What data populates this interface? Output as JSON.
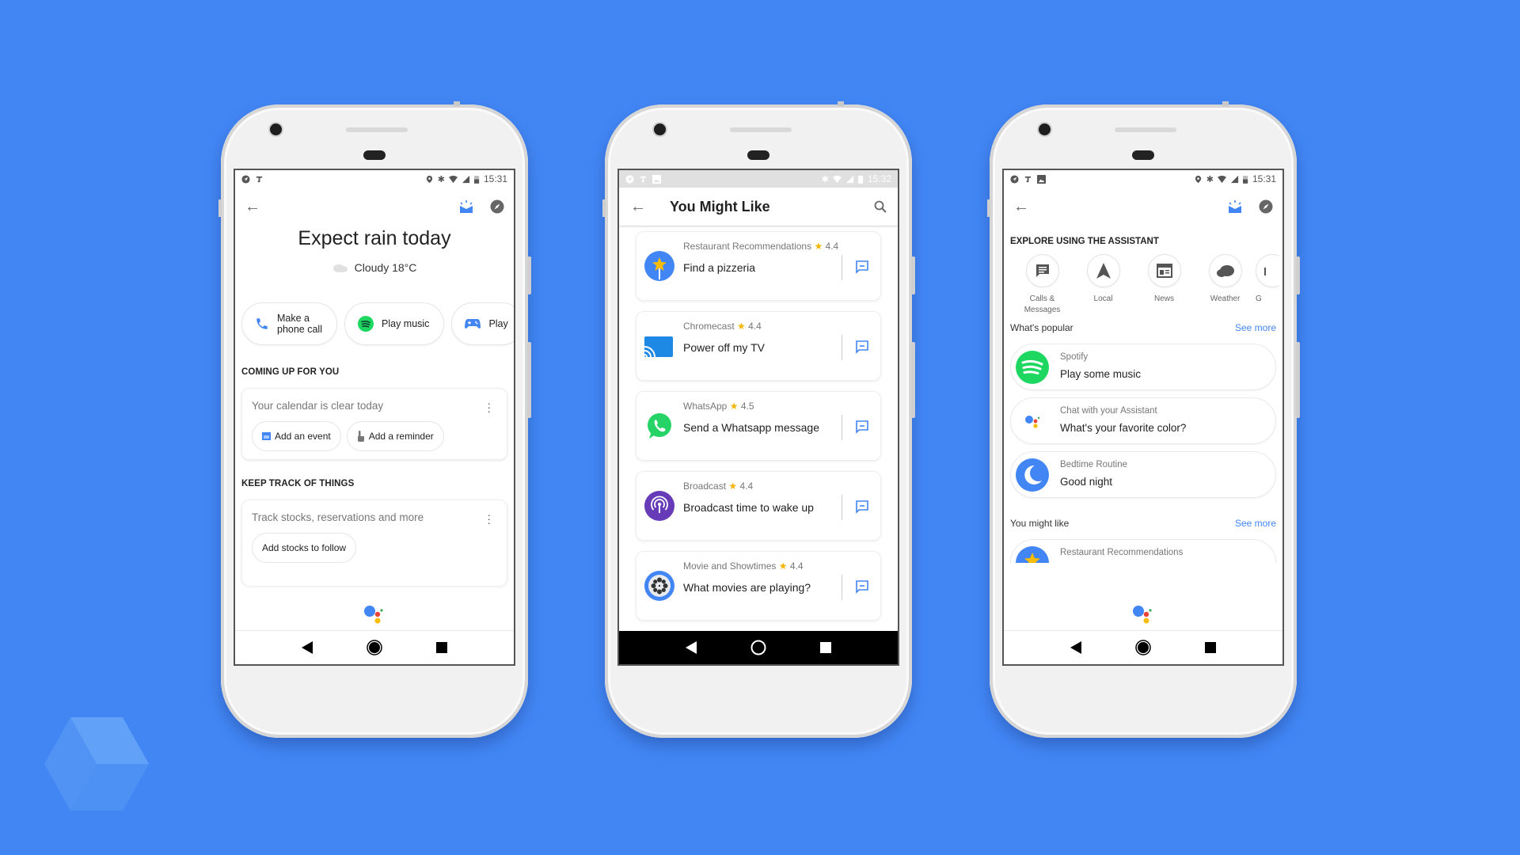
{
  "colors": {
    "background": "#4286f4",
    "accent_blue": "#4285f4",
    "spotify_green": "#1ed760",
    "whatsapp_green": "#25d366",
    "broadcast_purple": "#673ab7",
    "star_yellow": "#f5b400"
  },
  "phones": [
    {
      "status": {
        "left_icons": [
          "navigation-icon",
          "t-icon"
        ],
        "right_icons": [
          "location-icon",
          "bluetooth-icon",
          "wifi-icon",
          "signal-icon",
          "battery-icon"
        ],
        "time": "15:31"
      },
      "topbar": {
        "back": "back-arrow-icon",
        "icons": [
          "inbox-updates-icon",
          "explore-compass-icon"
        ]
      },
      "hero": {
        "title": "Expect rain today",
        "weather": "Cloudy 18°C"
      },
      "chips": [
        {
          "icon": "phone-icon",
          "label_line1": "Make a",
          "label_line2": "phone call"
        },
        {
          "icon": "spotify-icon",
          "label": "Play music"
        },
        {
          "icon": "gamepad-icon",
          "label": "Play"
        }
      ],
      "coming_up": {
        "heading": "COMING UP FOR YOU",
        "message": "Your calendar is clear today",
        "actions": [
          {
            "icon": "calendar-icon",
            "label": "Add an event"
          },
          {
            "icon": "reminder-hand-icon",
            "label": "Add a reminder"
          }
        ]
      },
      "keep_track": {
        "heading": "KEEP TRACK OF THINGS",
        "message": "Track stocks, reservations and more",
        "actions": [
          {
            "label": "Add stocks to follow"
          }
        ]
      }
    },
    {
      "status": {
        "left_icons": [
          "navigation-icon",
          "t-icon",
          "image-icon"
        ],
        "right_icons": [
          "bluetooth-icon",
          "wifi-icon",
          "signal-icon",
          "battery-icon"
        ],
        "time": "15:32"
      },
      "title": "You Might Like",
      "items": [
        {
          "category": "Restaurant Recommendations",
          "rating": "4.4",
          "query": "Find a pizzeria",
          "icon": "restaurant-icon"
        },
        {
          "category": "Chromecast",
          "rating": "4.4",
          "query": "Power off my TV",
          "icon": "chromecast-icon"
        },
        {
          "category": "WhatsApp",
          "rating": "4.5",
          "query": "Send a Whatsapp message",
          "icon": "whatsapp-icon"
        },
        {
          "category": "Broadcast",
          "rating": "4.4",
          "query": "Broadcast time to wake up",
          "icon": "broadcast-icon"
        },
        {
          "category": "Movie and Showtimes",
          "rating": "4.4",
          "query": "What movies are playing?",
          "icon": "movie-reel-icon"
        }
      ]
    },
    {
      "status": {
        "left_icons": [
          "navigation-icon",
          "t-icon",
          "image-icon"
        ],
        "right_icons": [
          "location-icon",
          "bluetooth-icon",
          "wifi-icon",
          "signal-icon",
          "battery-icon"
        ],
        "time": "15:31"
      },
      "explore_heading": "EXPLORE USING THE ASSISTANT",
      "explore": [
        {
          "icon": "message-icon",
          "label_line1": "Calls &",
          "label_line2": "Messages"
        },
        {
          "icon": "navigation-arrow-icon",
          "label_line1": "Local",
          "label_line2": ""
        },
        {
          "icon": "news-icon",
          "label_line1": "News",
          "label_line2": ""
        },
        {
          "icon": "cloud-icon",
          "label_line1": "Weather",
          "label_line2": ""
        },
        {
          "icon": "partial-icon",
          "label_line1": "G",
          "label_line2": ""
        }
      ],
      "popular": {
        "heading": "What's popular",
        "see_more": "See more",
        "items": [
          {
            "category": "Spotify",
            "query": "Play some music",
            "icon": "spotify-icon"
          },
          {
            "category": "Chat with your Assistant",
            "query": "What's your favorite color?",
            "icon": "assistant-icon"
          },
          {
            "category": "Bedtime Routine",
            "query": "Good night",
            "icon": "moon-icon"
          }
        ]
      },
      "might_like": {
        "heading": "You might like",
        "see_more": "See more",
        "items": [
          {
            "category": "Restaurant Recommendations",
            "icon": "restaurant-icon"
          }
        ]
      }
    }
  ]
}
